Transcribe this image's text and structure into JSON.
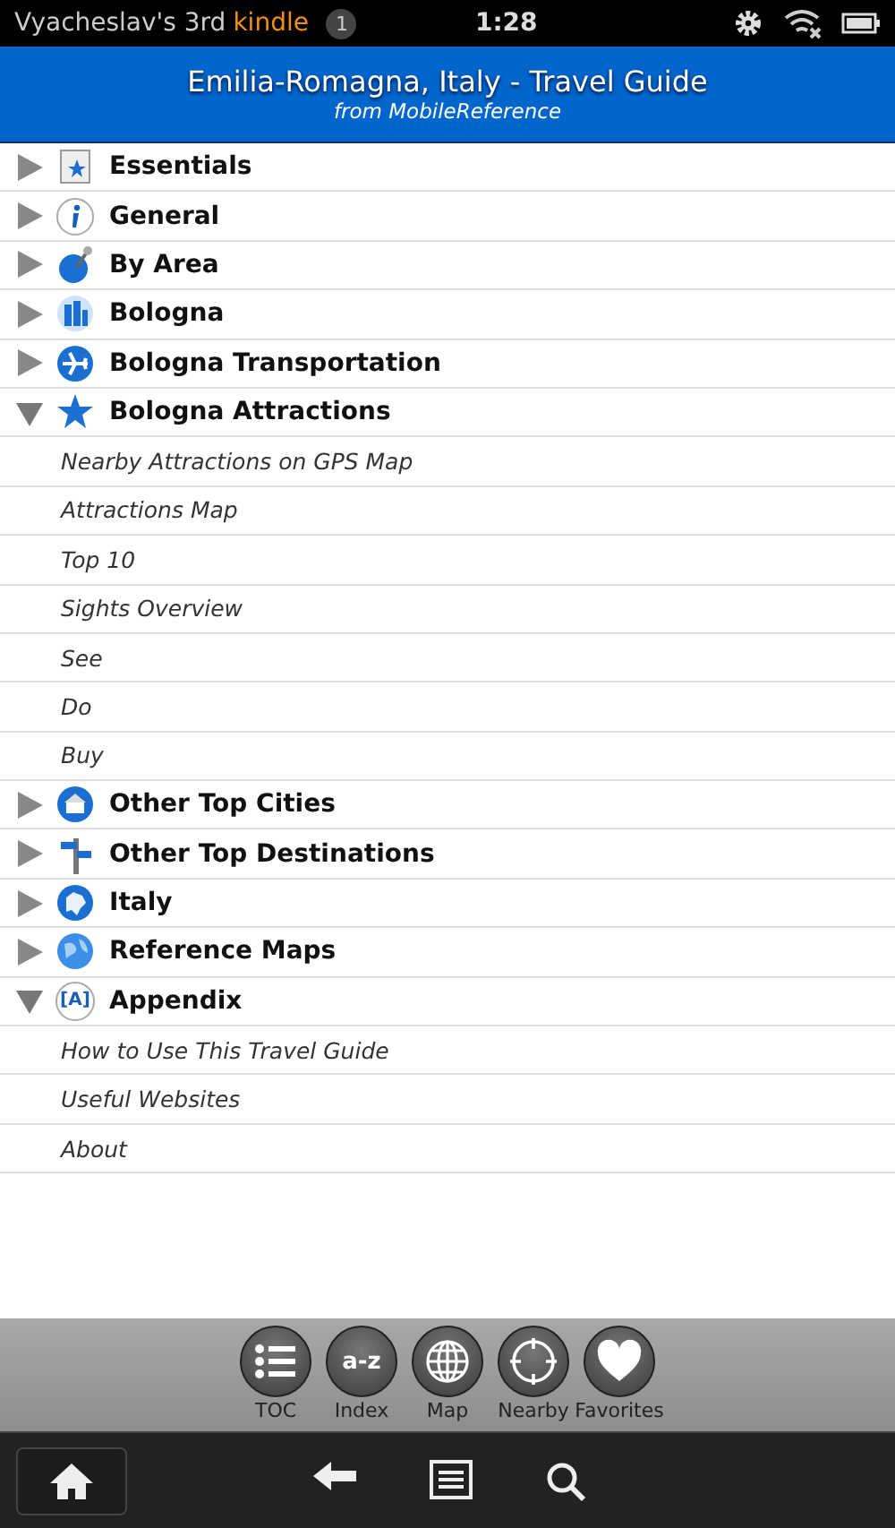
{
  "status_bar": {
    "device_name": "Vyacheslav's 3rd",
    "brand": "kindle",
    "notification_count": "1",
    "time": "1:28"
  },
  "header": {
    "title": "Emilia-Romagna, Italy - Travel Guide",
    "subtitle": "from MobileReference"
  },
  "sections": [
    {
      "label": "Essentials",
      "expanded": false
    },
    {
      "label": "General",
      "expanded": false
    },
    {
      "label": "By Area",
      "expanded": false
    },
    {
      "label": "Bologna",
      "expanded": false
    },
    {
      "label": "Bologna Transportation",
      "expanded": false
    },
    {
      "label": "Bologna Attractions",
      "expanded": true,
      "children": [
        {
          "label": "Nearby Attractions on GPS Map"
        },
        {
          "label": "Attractions Map"
        },
        {
          "label": "Top 10"
        },
        {
          "label": "Sights Overview"
        },
        {
          "label": "See"
        },
        {
          "label": "Do"
        },
        {
          "label": "Buy"
        }
      ]
    },
    {
      "label": "Other Top Cities",
      "expanded": false
    },
    {
      "label": "Other Top Destinations",
      "expanded": false
    },
    {
      "label": "Italy",
      "expanded": false
    },
    {
      "label": "Reference Maps",
      "expanded": false
    },
    {
      "label": "Appendix",
      "expanded": true,
      "icon_text": "[A]",
      "children": [
        {
          "label": "How to Use This Travel Guide"
        },
        {
          "label": "Useful Websites"
        },
        {
          "label": "About"
        }
      ]
    }
  ],
  "toolbar": [
    {
      "label": "TOC",
      "kind": "list"
    },
    {
      "label": "Index",
      "kind": "text",
      "glyph": "a-z"
    },
    {
      "label": "Map",
      "kind": "globe"
    },
    {
      "label": "Nearby",
      "kind": "target"
    },
    {
      "label": "Favorites",
      "kind": "heart"
    }
  ]
}
